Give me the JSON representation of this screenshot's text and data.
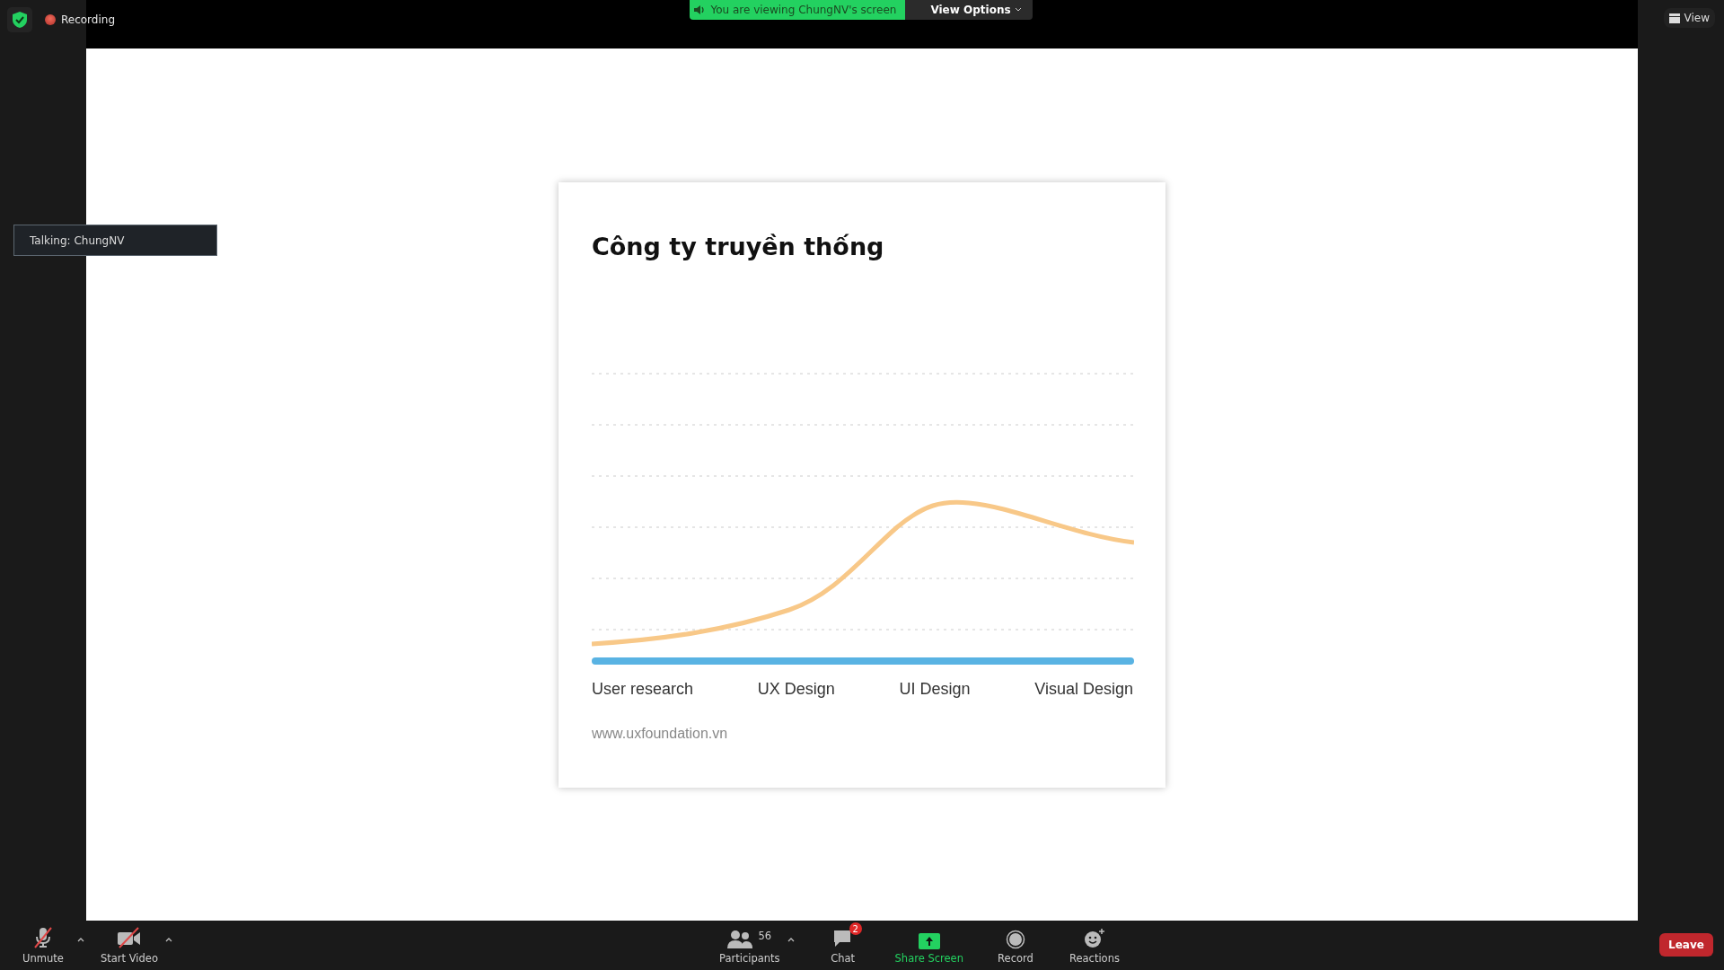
{
  "top_bar": {
    "recording_label": "Recording",
    "banner_text": "You are viewing ChungNV's screen",
    "view_options": "View Options",
    "view_button": "View"
  },
  "talking_tooltip": "Talking: ChungNV",
  "slide": {
    "title": "Công ty truyền thống",
    "categories": [
      "User research",
      "UX Design",
      "UI Design",
      "Visual Design"
    ],
    "footer": "www.uxfoundation.vn"
  },
  "toolbar": {
    "items": [
      {
        "kind": "mic",
        "label": "Unmute",
        "off": true,
        "menu": true
      },
      {
        "kind": "video",
        "label": "Start Video",
        "off": true,
        "menu": true
      },
      {
        "kind": "participants",
        "label": "Participants",
        "count": "56",
        "menu": true
      },
      {
        "kind": "chat",
        "label": "Chat",
        "badge": "2",
        "menu": false
      },
      {
        "kind": "share",
        "label": "Share Screen",
        "menu": false
      },
      {
        "kind": "record",
        "label": "Record",
        "menu": false
      },
      {
        "kind": "reactions",
        "label": "Reactions",
        "menu": false
      }
    ],
    "leave": "Leave"
  }
}
